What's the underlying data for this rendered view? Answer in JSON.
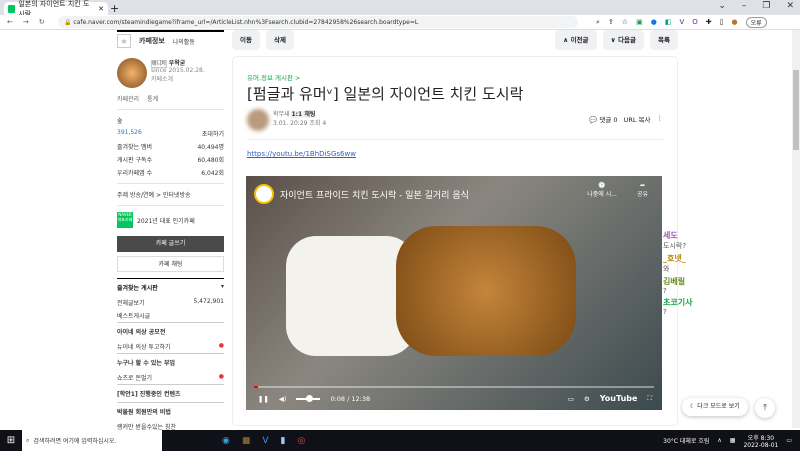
{
  "browser": {
    "tab_title": "일본의 자이언트 치킨 도시락",
    "url": "cafe.naver.com/steamindiegame?iframe_url=/ArticleList.nhn%3Fsearch.clubid=27842958%26search.boardtype=L",
    "profile_label": "오류"
  },
  "sidebar": {
    "tab_info": "카페정보",
    "tab_activity": "나의활동",
    "manager_badge": "매니저",
    "cafe_name": "우왁굳",
    "since": "since 2015.02.28.",
    "intro": "카페소개",
    "admin": "카페관리",
    "stats": "통계",
    "level": "숲",
    "members": "391,526",
    "invite": "초대하기",
    "fav_members_label": "즐겨찾는 멤버",
    "fav_members": "40,494명",
    "board_subs_label": "게시판 구독수",
    "board_subs": "60,480회",
    "our_cafe_label": "우리카페앱 수",
    "our_cafe": "6,042회",
    "topic": "주제 방송/연예 > 인터넷방송",
    "award": "2021년 대표 인기카페",
    "naver_badge": "NAVER 대표카페",
    "write_btn": "카페 글쓰기",
    "chat_btn": "카페 채팅",
    "sections": [
      {
        "title": "즐겨찾는 게시판",
        "items": [
          {
            "label": "전체글보기",
            "count": "5,472,901"
          },
          {
            "label": "베스트게시글",
            "count": ""
          }
        ]
      },
      {
        "title": "아이네 의상 공모전",
        "items": [
          {
            "label": "뉴이네 의상 투고하기",
            "count": ""
          }
        ]
      },
      {
        "title": "누구나 할 수 있는 부업",
        "items": [
          {
            "label": "쇼츠로 돈벌기",
            "count": ""
          }
        ]
      },
      {
        "title": "[학안1] 진행중인 컨텐츠",
        "items": []
      },
      {
        "title": "박물원 회원만의 비법",
        "items": [
          {
            "label": "랭커만 받을수있는 칭찬",
            "count": ""
          }
        ]
      }
    ]
  },
  "toolbar": {
    "move": "이동",
    "delete": "삭제",
    "prev": "이전글",
    "next": "다음글",
    "list": "목록"
  },
  "article": {
    "board": "유머,정보 게시판 >",
    "title": "[펌글과 유머ᵛ] 일본의 자이언트 치킨 도시락",
    "author_role": "왁무새",
    "chat_badge": "1:1 채팅",
    "date": "3.01. 20:29",
    "views": "조회 4",
    "comments": "댓글 0",
    "url_copy": "URL 복사",
    "link": "https://youtu.be/1BhDiSGs6ww"
  },
  "video": {
    "title": "자이언트 프라이드 치킨 도시락 - 일본 길거리 음식",
    "watch_later": "나중에 시...",
    "share": "공유",
    "time": "0:08 / 12:38",
    "progress": 0.011,
    "brand": "YouTube"
  },
  "chat": [
    {
      "name": "세도",
      "msg": "도시락?",
      "color": "#9b59b6"
    },
    {
      "name": "_호넷_",
      "msg": "와",
      "color": "#b8860b"
    },
    {
      "name": "김베릴",
      "msg": "?",
      "color": "#6b8e23"
    },
    {
      "name": "초코기사",
      "msg": "?",
      "color": "#16a34a"
    }
  ],
  "floating": {
    "dark_mode": "다크 모드로 보기"
  },
  "taskbar": {
    "search": "검색하려면 여기에 입력하십시오.",
    "weather": "30°C 대체로 흐림",
    "time": "오후 8:30",
    "date": "2022-08-01"
  }
}
